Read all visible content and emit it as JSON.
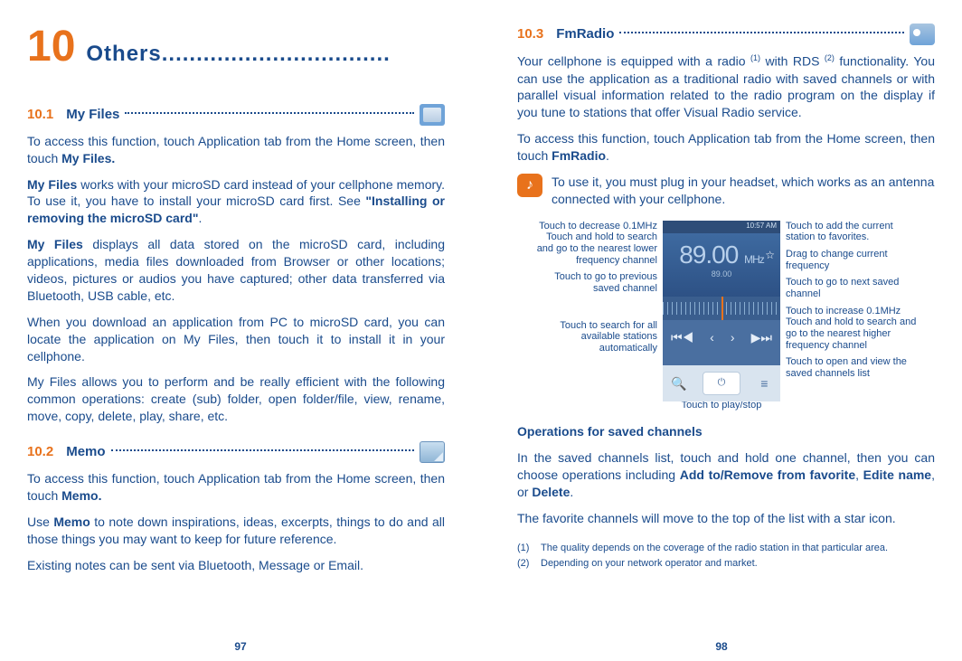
{
  "chapter": {
    "num": "10",
    "title": "Others",
    "dots": "................................."
  },
  "s101": {
    "num": "10.1",
    "title": "My Files",
    "p1a": "To access this function, touch Application tab from the Home screen, then touch ",
    "p1b": "My Files.",
    "p2a": "My Files",
    "p2b": " works with your microSD card instead of your cellphone memory. To use it, you have to install your microSD card first. See ",
    "p2c": "\"Installing or removing the microSD card\"",
    "p2d": ".",
    "p3a": "My Files",
    "p3b": " displays all data stored on the microSD card, including applications, media files downloaded from Browser or other locations; videos, pictures or audios you have captured; other data transferred via Bluetooth, USB cable, etc.",
    "p4": "When you download an application from PC to microSD card, you can locate the application on My Files, then touch it to install it in your cellphone.",
    "p5": "My Files allows you to perform and be really efficient with the following common operations: create (sub) folder, open folder/file, view, rename, move, copy, delete, play, share, etc."
  },
  "s102": {
    "num": "10.2",
    "title": "Memo",
    "p1a": "To access this function, touch Application tab from the Home screen, then touch ",
    "p1b": "Memo.",
    "p2a": "Use ",
    "p2b": "Memo",
    "p2c": " to note down inspirations, ideas, excerpts, things to do and all those things you may want to keep for future reference.",
    "p3": "Existing notes can be sent via Bluetooth, Message or Email."
  },
  "s103": {
    "num": "10.3",
    "title": "FmRadio",
    "p1a": "Your cellphone is equipped with a radio ",
    "p1b": " with RDS ",
    "p1c": " functionality. You can use the application as a traditional radio with saved channels or with parallel visual information related to the radio program on the display if you tune to stations that offer Visual Radio service.",
    "p2a": "To access this function, touch Application tab from the Home screen, then touch ",
    "p2b": "FmRadio",
    "p2c": ".",
    "note": "To use it, you must plug in your headset, which works as an antenna connected with your cellphone.",
    "left": {
      "l1": "Touch to decrease 0.1MHz Touch and hold to search and go to the nearest lower frequency channel",
      "l2": "Touch to go to previous saved channel",
      "l3": "Touch to search for all available stations automatically"
    },
    "right": {
      "r1": "Touch to add the current station to favorites.",
      "r2": "Drag to change current frequency",
      "r3": "Touch to go to next saved channel",
      "r4": "Touch to increase 0.1MHz Touch and hold to search and go to the nearest higher frequency channel",
      "r5": "Touch to open and view the saved channels list"
    },
    "playstop": "Touch to play/stop",
    "phone": {
      "time": "10:57 AM",
      "freq": "89.00",
      "unit": "MHz",
      "freq_sm": "89.00"
    },
    "ops_h": "Operations for saved channels",
    "ops1a": "In the saved channels list, touch and hold one channel, then you can choose operations including ",
    "ops1b": "Add to/Remove from favorite",
    "ops1c": ", ",
    "ops1d": "Edite name",
    "ops1e": ", or ",
    "ops1f": "Delete",
    "ops1g": ".",
    "ops2": "The favorite channels will move to the top of the list with a star icon."
  },
  "footnotes": {
    "m1": "(1)",
    "t1": "The quality depends on the coverage of the radio station in that particular area.",
    "m2": "(2)",
    "t2": "Depending on your network operator and market."
  },
  "pages": {
    "left": "97",
    "right": "98"
  }
}
